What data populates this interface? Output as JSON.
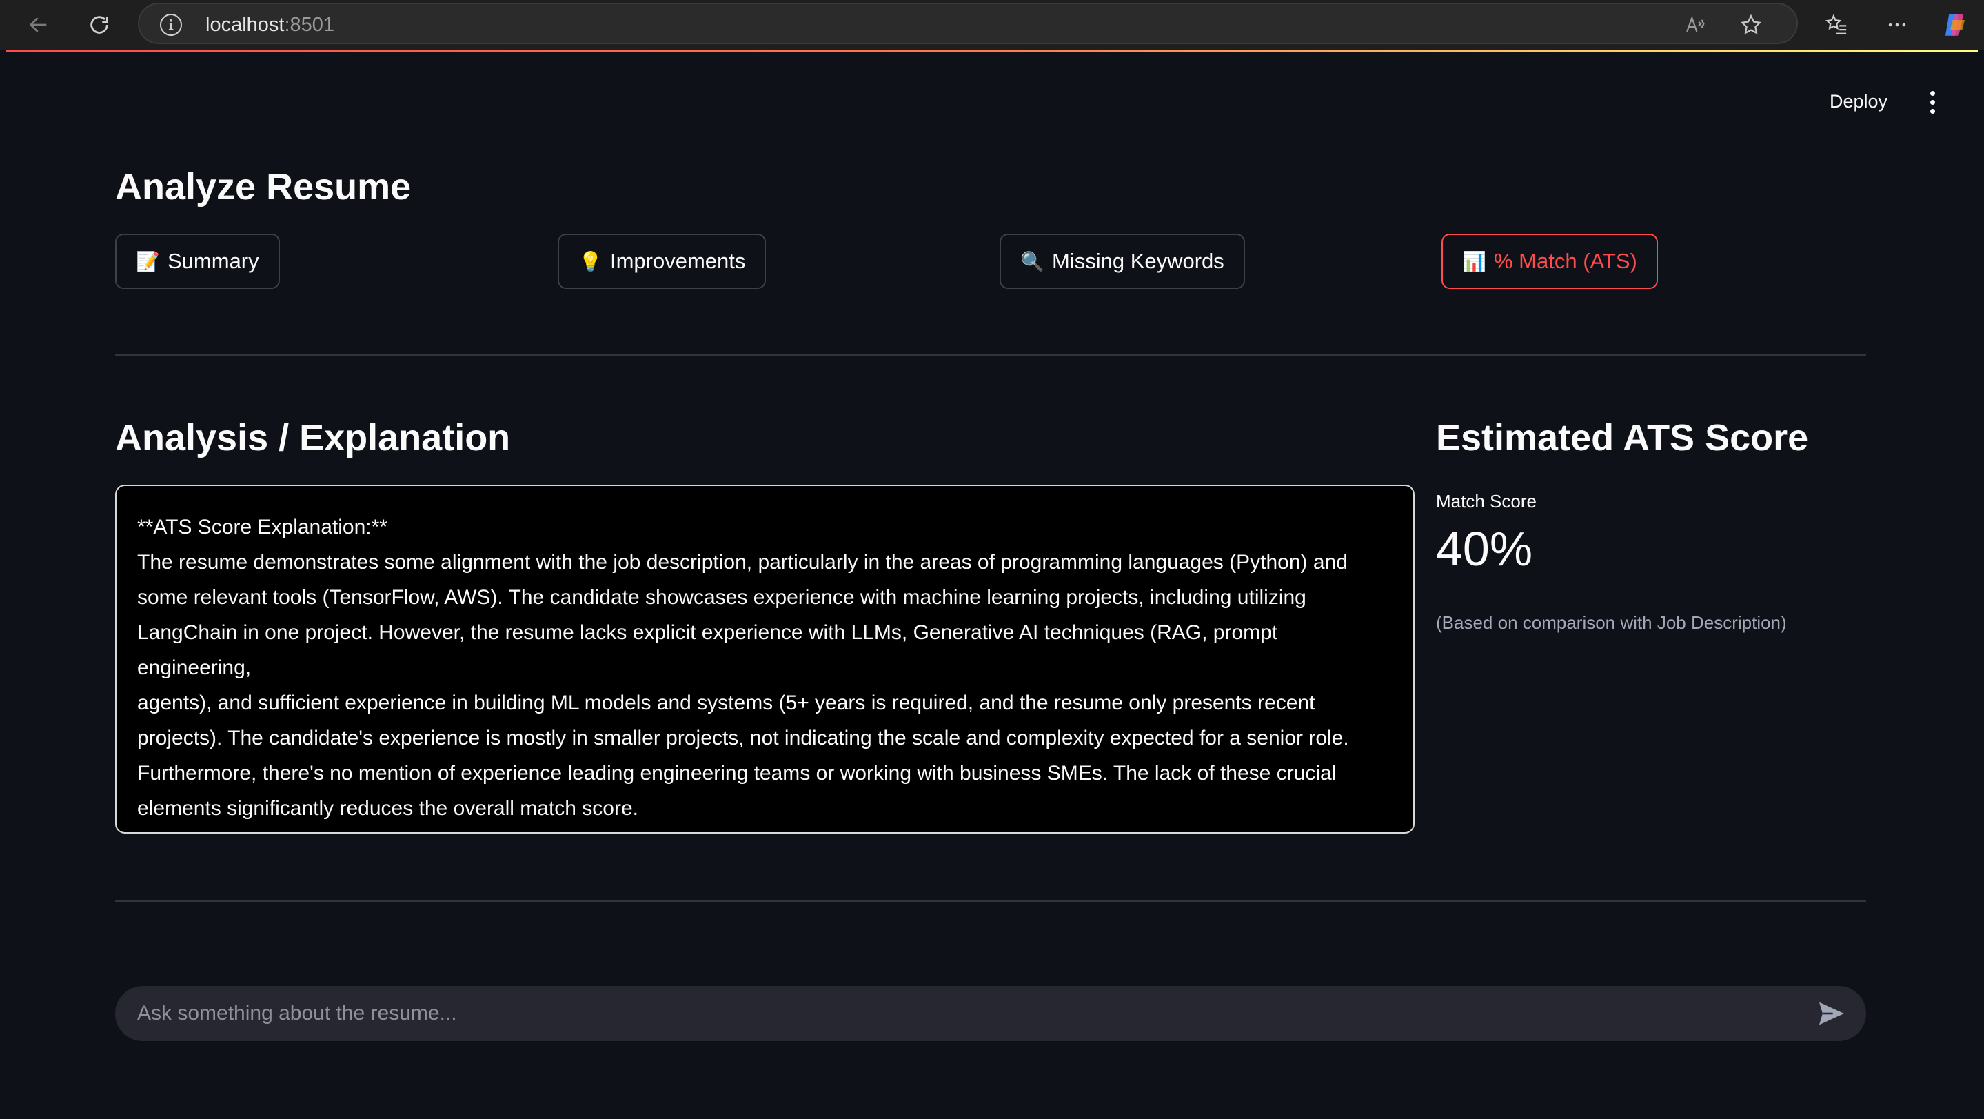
{
  "browser": {
    "url_host": "localhost",
    "url_port": ":8501"
  },
  "header": {
    "deploy_label": "Deploy"
  },
  "page": {
    "title": "Analyze Resume"
  },
  "actions": [
    {
      "emoji": "📝",
      "label": "Summary"
    },
    {
      "emoji": "💡",
      "label": "Improvements"
    },
    {
      "emoji": "🔍",
      "label": "Missing Keywords"
    },
    {
      "emoji": "📊",
      "label": "% Match (ATS)"
    }
  ],
  "analysis": {
    "heading": "Analysis / Explanation",
    "lines": [
      "**ATS Score Explanation:**",
      "The resume demonstrates some alignment with the job description, particularly in the areas of programming languages (Python) and",
      "some relevant tools (TensorFlow, AWS). The candidate showcases experience with machine learning projects, including utilizing",
      "LangChain in one project. However, the resume lacks explicit experience with LLMs, Generative AI techniques (RAG, prompt engineering,",
      "agents), and sufficient experience in building ML models and systems (5+ years is required, and the resume only presents recent",
      "projects). The candidate's experience is mostly in smaller projects, not indicating the scale and complexity expected for a senior role.",
      "Furthermore, there's no mention of experience leading engineering teams or working with business SMEs. The lack of these crucial",
      "elements significantly reduces the overall match score."
    ]
  },
  "ats": {
    "heading": "Estimated ATS Score",
    "metric_label": "Match Score",
    "metric_value": "40%",
    "note": "(Based on comparison with Job Description)"
  },
  "chat": {
    "placeholder": "Ask something about the resume..."
  },
  "colors": {
    "background": "#0e1117",
    "accent": "#ff4b4b",
    "chat_input_bg": "#262730"
  }
}
